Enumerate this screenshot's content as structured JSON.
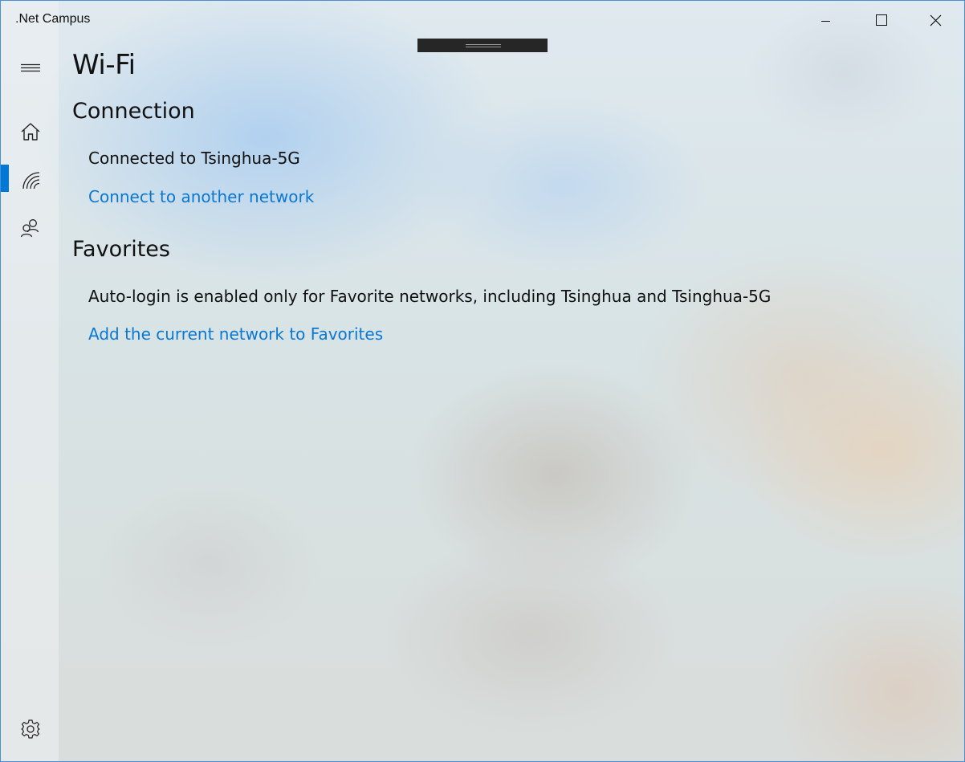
{
  "window": {
    "title": ".Net Campus",
    "controls": {
      "minimize_icon": "minimize-icon",
      "maximize_icon": "maximize-icon",
      "close_icon": "close-icon"
    }
  },
  "sidebar": {
    "items": [
      {
        "id": "hamburger",
        "icon": "hamburger-icon"
      },
      {
        "id": "home",
        "icon": "home-icon"
      },
      {
        "id": "wifi",
        "icon": "wifi-icon",
        "selected": true
      },
      {
        "id": "accounts",
        "icon": "people-icon"
      }
    ],
    "footer": {
      "id": "settings",
      "icon": "gear-icon"
    },
    "accent_color": "#0078d7"
  },
  "page": {
    "title": "Wi-Fi",
    "connection": {
      "heading": "Connection",
      "status": "Connected to Tsinghua-5G",
      "action_link": "Connect to another network"
    },
    "favorites": {
      "heading": "Favorites",
      "description": "Auto-login is enabled only for Favorite networks, including Tsinghua and Tsinghua-5G",
      "action_link": "Add the current network to Favorites"
    }
  },
  "colors": {
    "link": "#0a78d2",
    "text": "#111111",
    "selection_indicator": "#0078d7"
  }
}
